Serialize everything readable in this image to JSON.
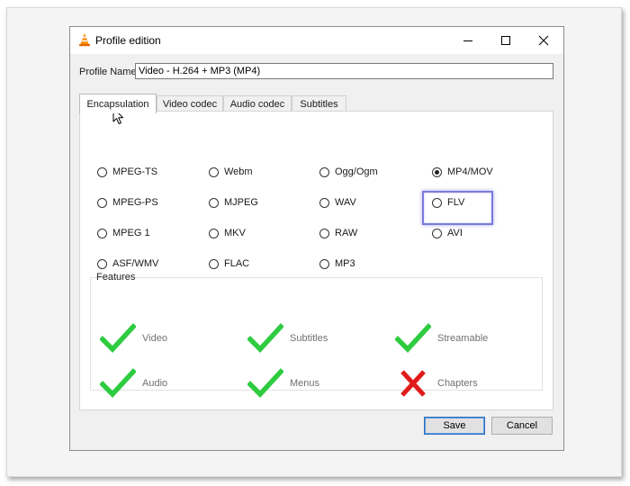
{
  "window": {
    "title": "Profile edition",
    "controls": {
      "minimize_icon": "minimize-icon",
      "maximize_icon": "maximize-icon",
      "close_icon": "close-icon"
    }
  },
  "profile": {
    "label": "Profile Name",
    "value": "Video - H.264 + MP3 (MP4)"
  },
  "tabs": [
    {
      "label": "Encapsulation",
      "active": true
    },
    {
      "label": "Video codec",
      "active": false
    },
    {
      "label": "Audio codec",
      "active": false
    },
    {
      "label": "Subtitles",
      "active": false
    }
  ],
  "encapsulation": {
    "options": [
      {
        "label": "MPEG-TS",
        "checked": false
      },
      {
        "label": "Webm",
        "checked": false
      },
      {
        "label": "Ogg/Ogm",
        "checked": false
      },
      {
        "label": "MP4/MOV",
        "checked": true
      },
      {
        "label": "MPEG-PS",
        "checked": false
      },
      {
        "label": "MJPEG",
        "checked": false
      },
      {
        "label": "WAV",
        "checked": false
      },
      {
        "label": "FLV",
        "checked": false
      },
      {
        "label": "MPEG 1",
        "checked": false
      },
      {
        "label": "MKV",
        "checked": false
      },
      {
        "label": "RAW",
        "checked": false
      },
      {
        "label": "AVI",
        "checked": false
      },
      {
        "label": "ASF/WMV",
        "checked": false
      },
      {
        "label": "FLAC",
        "checked": false
      },
      {
        "label": "MP3",
        "checked": false
      }
    ],
    "highlighted": "AVI"
  },
  "features": {
    "label": "Features",
    "items": [
      {
        "label": "Video",
        "supported": true
      },
      {
        "label": "Subtitles",
        "supported": true
      },
      {
        "label": "Streamable",
        "supported": true
      },
      {
        "label": "Audio",
        "supported": true
      },
      {
        "label": "Menus",
        "supported": true
      },
      {
        "label": "Chapters",
        "supported": false
      }
    ]
  },
  "buttons": {
    "save": "Save",
    "cancel": "Cancel"
  },
  "colors": {
    "check": "#2ecc40",
    "cross": "#e01b1b",
    "highlight": "#7b7bdc",
    "default_button": "#2f6fbf"
  }
}
